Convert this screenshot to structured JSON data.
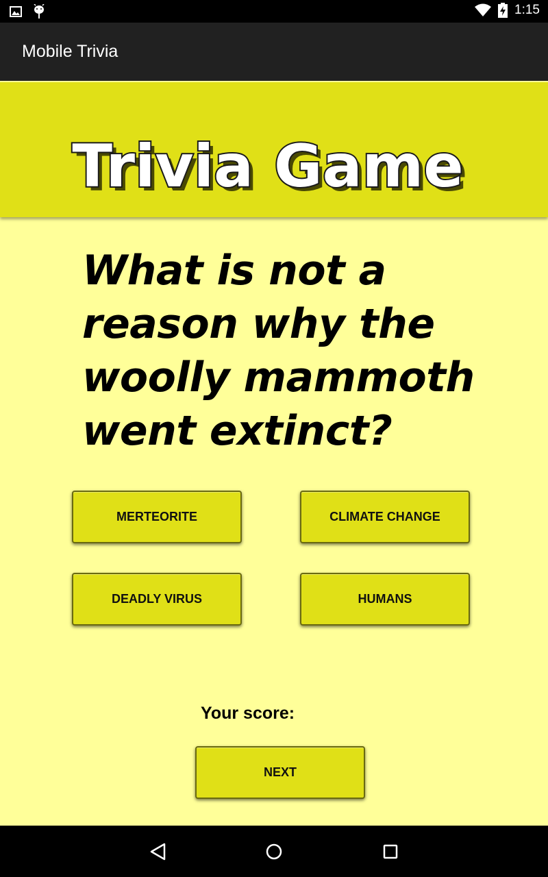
{
  "status_bar": {
    "time": "1:15",
    "icons": [
      "image-icon",
      "android-debug-icon",
      "wifi-icon",
      "battery-charging-icon"
    ]
  },
  "action_bar": {
    "title": "Mobile Trivia"
  },
  "banner": {
    "logo_text": "Trivia Game"
  },
  "question": {
    "text": "What is not a reason why the woolly mammoth went extinct?"
  },
  "answers": [
    {
      "label": "MERTEORITE"
    },
    {
      "label": "CLIMATE CHANGE"
    },
    {
      "label": "DEADLY VIRUS"
    },
    {
      "label": "HUMANS"
    }
  ],
  "score": {
    "label": "Your score:"
  },
  "next_button": {
    "label": "NEXT"
  },
  "nav_bar": {
    "icons": [
      "back-icon",
      "home-icon",
      "recents-icon"
    ]
  },
  "colors": {
    "background": "#ffff99",
    "accent": "#e0e017",
    "action_bar": "#212121"
  }
}
